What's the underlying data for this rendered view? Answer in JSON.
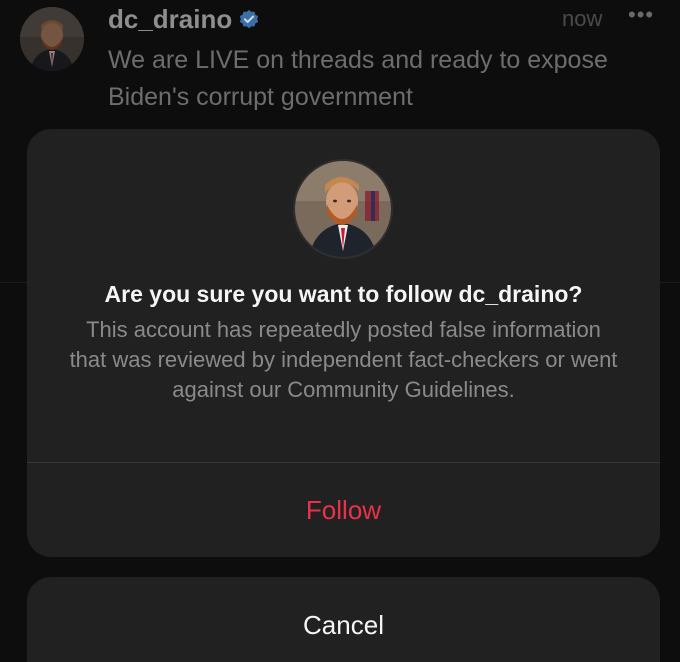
{
  "post": {
    "username": "dc_draino",
    "time": "now",
    "more_icon": "•••",
    "text": "We are LIVE on threads and ready to expose Biden's corrupt government"
  },
  "dialog": {
    "title": "Are you sure you want to follow dc_draino?",
    "message": "This account has repeatedly posted false information that was reviewed by independent fact-checkers or went against our Community Guidelines.",
    "follow_label": "Follow",
    "cancel_label": "Cancel"
  },
  "colors": {
    "follow_accent": "#e8324b",
    "verified_blue": "#3897f0",
    "dialog_bg": "#212121"
  },
  "icons": {
    "verified": "verified-badge-icon",
    "more": "more-options-icon"
  }
}
